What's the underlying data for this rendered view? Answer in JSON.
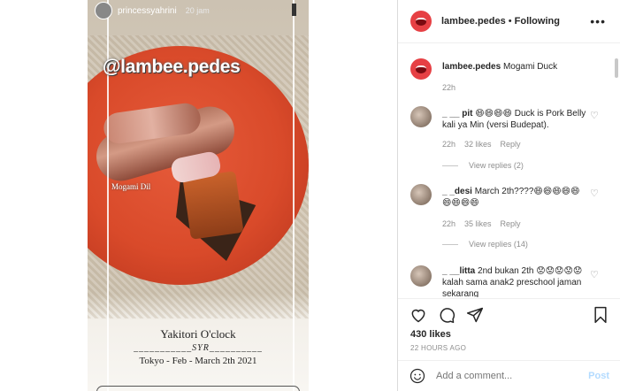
{
  "story": {
    "username": "princessyahrini",
    "time": "20 jam",
    "watermark": "@lambee.pedes",
    "small_tag": "Mogami Dil",
    "caption_line1": "Yakitori O'clock",
    "caption_line2": "___________SYR__________",
    "caption_line3": "Tokyo - Feb - March 2th 2021"
  },
  "header": {
    "username": "lambee.pedes",
    "separator": "•",
    "following": "Following",
    "more": "•••"
  },
  "caption": {
    "username": "lambee.pedes",
    "text": "Mogami Duck",
    "time": "22h"
  },
  "comments": [
    {
      "username": "_ __ pit",
      "text": "😄😄😄😄 Duck is Pork Belly kali ya Min (versi Budepat).",
      "time": "22h",
      "likes": "32 likes",
      "reply": "Reply",
      "view_replies": "View replies (2)"
    },
    {
      "username": "_ _desi",
      "text": "March 2th????😄😄😄😄😄😄😄😄😄",
      "time": "22h",
      "likes": "35 likes",
      "reply": "Reply",
      "view_replies": "View replies (14)"
    },
    {
      "username": "_ __litta",
      "text": "2nd bukan 2th 😟😟😟😟😟kalah sama anak2 preschool jaman sekarang",
      "time": "",
      "likes": "",
      "reply": "",
      "view_replies": ""
    }
  ],
  "actions": {
    "likes": "430 likes",
    "date": "22 HOURS AGO"
  },
  "add_comment": {
    "placeholder": "Add a comment...",
    "post": "Post"
  },
  "icons": [
    "like-icon",
    "comment-icon",
    "share-icon",
    "bookmark-icon",
    "emoji-icon",
    "heart-icon",
    "more-icon"
  ],
  "colors": {
    "avatar_red": "#e64044",
    "muted": "#8e8e8e",
    "post_disabled": "#b3dbff",
    "border": "#dbdbdb"
  }
}
